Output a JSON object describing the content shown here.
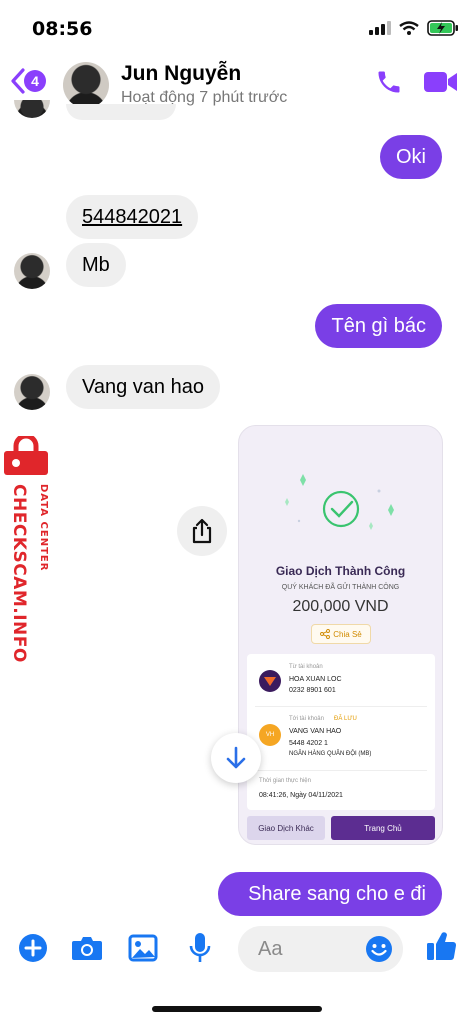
{
  "status_bar": {
    "time": "08:56"
  },
  "header": {
    "back_badge": "4",
    "contact_name": "Jun Nguyễn",
    "contact_status": "Hoạt động 7 phút trước"
  },
  "messages": [
    {
      "id": "m1",
      "direction": "out",
      "text": "Oki"
    },
    {
      "id": "m2",
      "direction": "in",
      "text": "544842021"
    },
    {
      "id": "m3",
      "direction": "in",
      "text": "Mb"
    },
    {
      "id": "m4",
      "direction": "out",
      "text": "Tên gì bác"
    },
    {
      "id": "m5",
      "direction": "in",
      "text": "Vang van hao"
    },
    {
      "id": "m7",
      "direction": "out",
      "text": "Share sang cho e đi"
    }
  ],
  "receipt": {
    "title": "Giao Dịch Thành Công",
    "subtitle": "QUÝ KHÁCH ĐÃ GỬI THÀNH CÔNG",
    "amount": "200,000 VND",
    "share_label": "Chia Sẻ",
    "from_label": "Từ tài khoản",
    "from_name": "HOA XUAN LOC",
    "from_account": "0232 8901 601",
    "to_label": "Tới tài khoản",
    "to_saved": "ĐÃ LƯU",
    "to_avatar": "VH",
    "to_name": "VANG VAN HAO",
    "to_account": "5448 4202 1",
    "to_bank": "NGÂN HÀNG QUÂN ĐỘI (MB)",
    "time_label": "Thời gian thực hiện",
    "time_value": "08:41:26, Ngày 04/11/2021",
    "btn_other": "Giao Dịch Khác",
    "btn_home": "Trang Chủ"
  },
  "watermark": {
    "line1": "DATA CENTER",
    "line2": "CHECKSCAM.INFO"
  },
  "composer": {
    "placeholder": "Aa"
  },
  "colors": {
    "accent": "#7a3fe6",
    "watermark": "#e0262b"
  }
}
